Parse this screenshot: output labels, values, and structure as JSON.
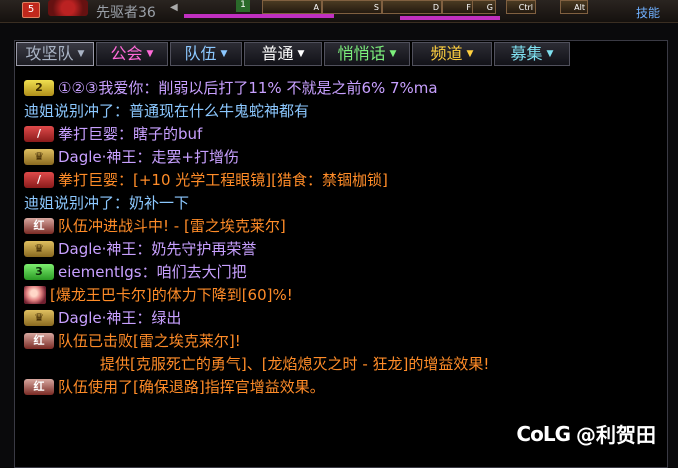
{
  "hud": {
    "level": "5",
    "player_name": "先驱者36",
    "slot_label": "1",
    "keys": [
      "A",
      "S",
      "D",
      "F",
      "G",
      "Ctrl",
      "Alt"
    ],
    "skill_label": "技能"
  },
  "tabs": [
    {
      "label": "攻坚队",
      "color": "#a9b3c4"
    },
    {
      "label": "公会",
      "color": "#ff6ad8"
    },
    {
      "label": "队伍",
      "color": "#8cc8ff"
    },
    {
      "label": "普通",
      "color": "#ffffff"
    },
    {
      "label": "悄悄话",
      "color": "#7cf07c"
    },
    {
      "label": "频道",
      "color": "#ffd040"
    },
    {
      "label": "募集",
      "color": "#7fe0f0"
    }
  ],
  "messages": [
    {
      "badge": "rank2",
      "badge_text": "2",
      "text": "①②③我爱你：削弱以后打了11% 不就是之前6% 7%ma",
      "color": "#c8a0ff"
    },
    {
      "badge": "",
      "badge_text": "",
      "text": "迪姐说别冲了：普通现在什么牛鬼蛇神都有",
      "color": "#8cc8ff"
    },
    {
      "badge": "fist",
      "badge_text": "/",
      "text": "拳打巨婴：瞎子的buf",
      "color": "#c8a0ff"
    },
    {
      "badge": "crown",
      "badge_text": "♛",
      "text": "Dagle·神王：走罢+打增伤",
      "color": "#c8a0ff"
    },
    {
      "badge": "fist",
      "badge_text": "/",
      "text": "拳打巨婴：[+10 光学工程眼镜][猎食：禁锢枷锁]",
      "color": "#ff8c28"
    },
    {
      "badge": "",
      "badge_text": "",
      "text": "迪姐说别冲了：奶补一下",
      "color": "#8cc8ff"
    },
    {
      "badge": "red",
      "badge_text": "红",
      "text": "队伍冲进战斗中! - [雷之埃克莱尔]",
      "color": "#ff8c28"
    },
    {
      "badge": "crown",
      "badge_text": "♛",
      "text": "Dagle·神王：奶先守护再荣誉",
      "color": "#c8a0ff"
    },
    {
      "badge": "rank3",
      "badge_text": "3",
      "text": "eiementIgs：咱们去大门把",
      "color": "#c8a0ff"
    },
    {
      "badge": "avatar",
      "badge_text": "",
      "text": "[爆龙王巴卡尔]的体力下降到[60]%!",
      "color": "#ff8c28"
    },
    {
      "badge": "crown",
      "badge_text": "♛",
      "text": "Dagle·神王：绿出",
      "color": "#c8a0ff"
    },
    {
      "badge": "red",
      "badge_text": "红",
      "text": "队伍已击败[雷之埃克莱尔]!",
      "color": "#ff8c28"
    },
    {
      "badge": "indent",
      "badge_text": "",
      "text": "提供[克服死亡的勇气]、[龙焰熄灭之时 - 狂龙]的增益效果!",
      "color": "#ff8c28"
    },
    {
      "badge": "red",
      "badge_text": "红",
      "text": "队伍使用了[确保退路]指挥官增益效果。",
      "color": "#ff8c28"
    }
  ],
  "watermark": {
    "logo": "CoLG",
    "text": "@利贺田"
  }
}
